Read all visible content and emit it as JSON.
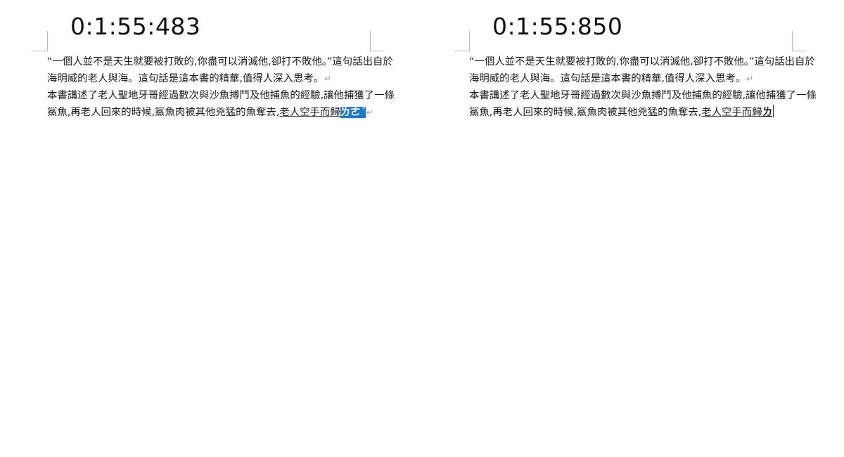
{
  "frames": [
    {
      "timer": "0:1:55:483",
      "lines": [
        "“一個人並不是天生就要被打敗的,你盡可以消滅他,卻打不敗他。”這句話出自於",
        "海明威的老人與海。這句話是這本書的精華,值得人深入思考。",
        "本書講述了老人聖地牙哥經過數次與沙魚搏鬥及他捕魚的經驗,讓他捕獲了一條",
        "鯊魚,再老人回來的時候,鯊魚肉被其他兇猛的魚奪去,"
      ],
      "underlined_text": "老人空手而歸",
      "ime_composition": "ㄌㄜˊ",
      "paragraph_mark": "↵"
    },
    {
      "timer": "0:1:55:850",
      "lines": [
        "“一個人並不是天生就要被打敗的,你盡可以消滅他,卻打不敗他。”這句話出自於",
        "海明威的老人與海。這句話是這本書的精華,值得人深入思考。",
        "本書講述了老人聖地牙哥經過數次與沙魚搏鬥及他捕魚的經驗,讓他捕獲了一條",
        "鯊魚,再老人回來的時候,鯊魚肉被其他兇猛的魚奪去,"
      ],
      "underlined_text": "老人空手而歸",
      "ime_composition": "ㄌ",
      "paragraph_mark": "↵"
    }
  ]
}
